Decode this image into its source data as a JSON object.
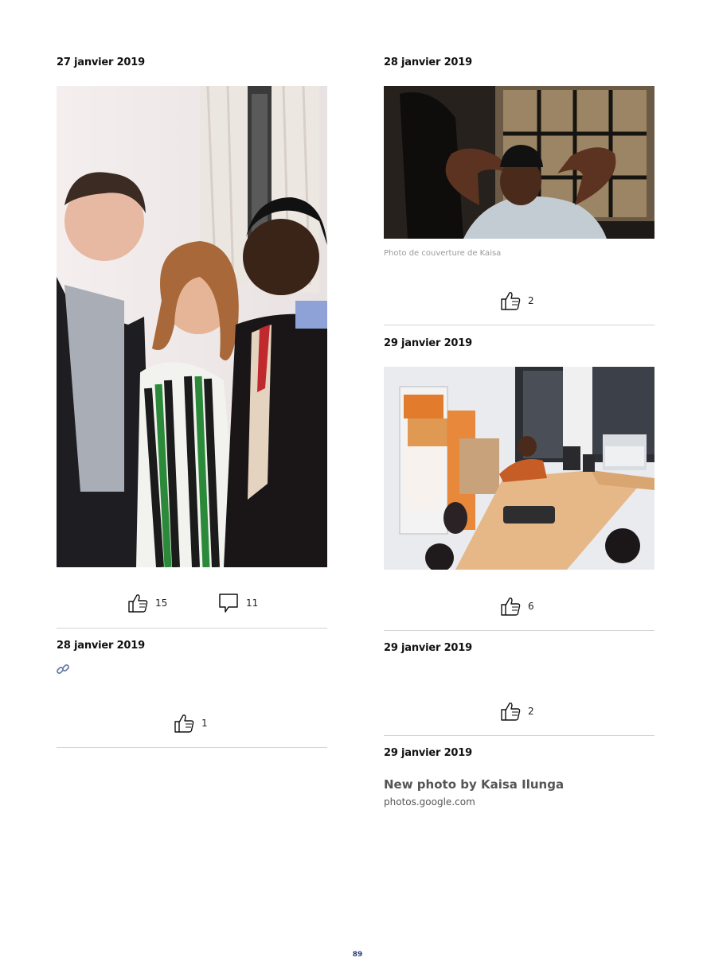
{
  "posts": {
    "p1": {
      "date": "27 janvier 2019",
      "likes": "15",
      "comments": "11"
    },
    "p2": {
      "date": "28 janvier 2019",
      "likes": "1"
    },
    "p3": {
      "date": "28 janvier 2019",
      "caption": "Photo de couverture de Kaisa",
      "likes": "2"
    },
    "p4": {
      "date": "29 janvier 2019",
      "likes": "6"
    },
    "p5": {
      "date": "29 janvier 2019",
      "likes": "2"
    },
    "p6": {
      "date": "29 janvier 2019",
      "link_title": "New photo by Kaisa Ilunga",
      "link_domain": "photos.google.com"
    }
  },
  "icons": {
    "like": "thumbs-up-icon",
    "comment": "speech-bubble-icon",
    "link": "link-chain-icon"
  },
  "colors": {
    "page_number": "#2a3d7a",
    "rule": "#d4d4d4"
  },
  "footer": {
    "page_number": "89"
  }
}
